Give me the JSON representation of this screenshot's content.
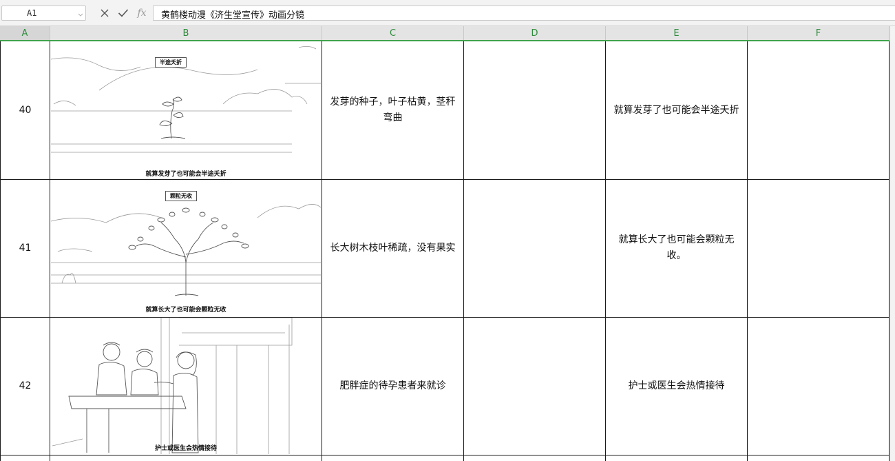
{
  "formula_bar": {
    "cell_reference": "A1",
    "fx_label": "fx",
    "content": "黄鹤楼动漫《济生堂宣传》动画分镜"
  },
  "columns": [
    "A",
    "B",
    "C",
    "D",
    "E",
    "F"
  ],
  "rows": [
    {
      "number": "40",
      "panel_tag": "半途夭折",
      "panel_caption": "就算发芽了也可能会半途夭折",
      "description": "发芽的种子，叶子枯黄，茎秆弯曲",
      "d": "",
      "narration": "就算发芽了也可能会半途夭折",
      "f": ""
    },
    {
      "number": "41",
      "panel_tag": "颗粒无收",
      "panel_caption": "就算长大了也可能会颗粒无收",
      "description": "长大树木枝叶稀疏，没有果实",
      "d": "",
      "narration": "就算长大了也可能会颗粒无收。",
      "f": ""
    },
    {
      "number": "42",
      "panel_tag": "",
      "panel_caption": "护士或医生会热情接待",
      "description": "肥胖症的待孕患者来就诊",
      "d": "",
      "narration": "护士或医生会热情接待",
      "f": ""
    }
  ],
  "colors": {
    "header_accent": "#3fa34d",
    "header_text": "#2e8b3c",
    "gridline": "#1a1a1a"
  }
}
